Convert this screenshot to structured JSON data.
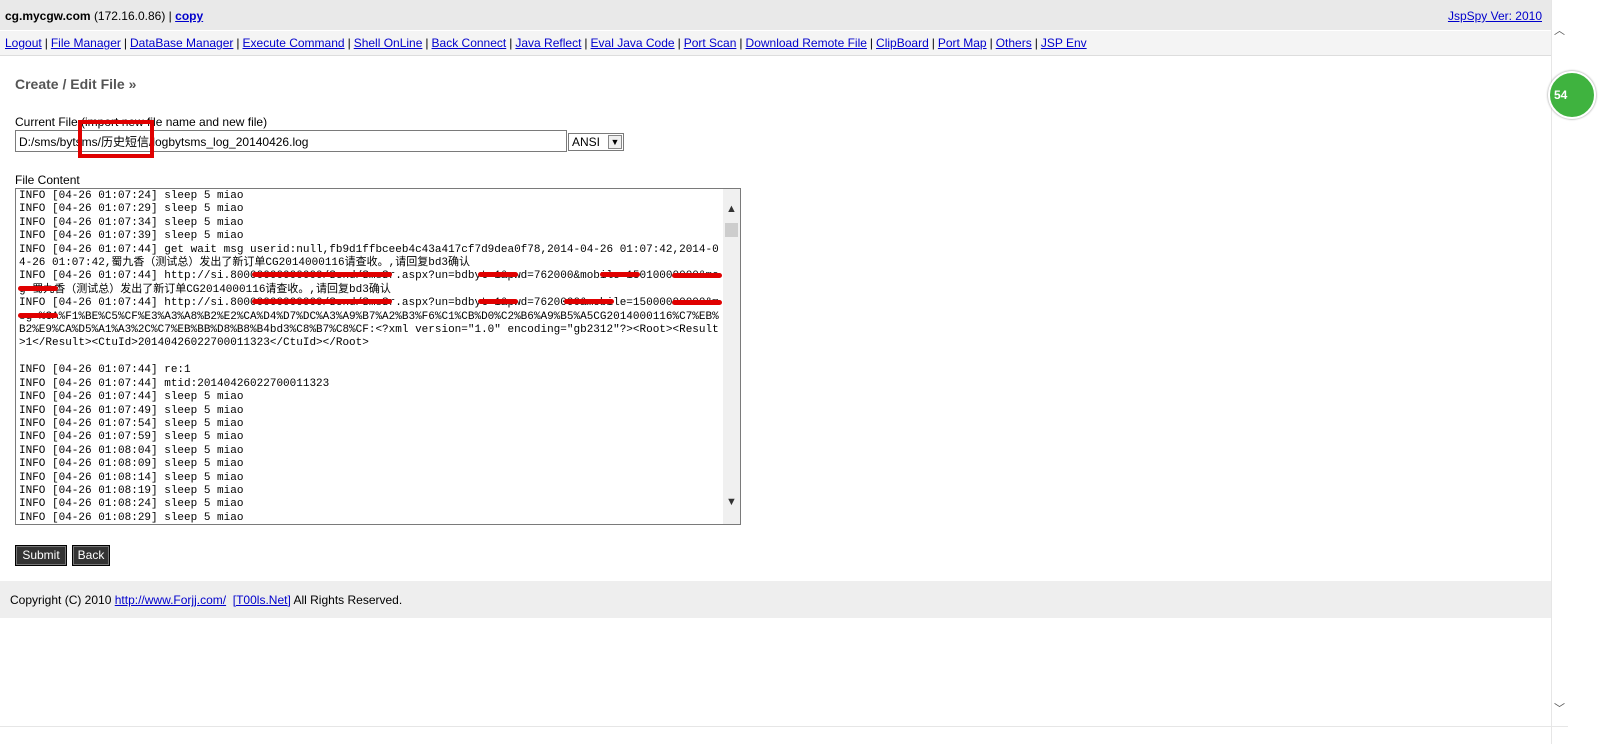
{
  "header": {
    "host": "cg.mycgw.com",
    "ip": "(172.16.0.86)",
    "sep": "|",
    "copy": "copy",
    "version": "JspSpy Ver: 2010"
  },
  "nav": [
    "Logout",
    "File Manager",
    "DataBase Manager",
    "Execute Command",
    "Shell OnLine",
    "Back Connect",
    "Java Reflect",
    "Eval Java Code",
    "Port Scan",
    "Download Remote File",
    "ClipBoard",
    "Port Map",
    "Others",
    "JSP Env"
  ],
  "title": "Create / Edit File »",
  "current_file_label": "Current File (import new file name and new file)",
  "current_file_value": "D:/sms/bytsms/历史短信/logbytsms_log_20140426.log",
  "encoding": "ANSI",
  "content_label": "File Content",
  "file_content": "INFO [04-26 01:07:24] sleep 5 miao\nINFO [04-26 01:07:29] sleep 5 miao\nINFO [04-26 01:07:34] sleep 5 miao\nINFO [04-26 01:07:39] sleep 5 miao\nINFO [04-26 01:07:44] get wait msg userid:null,fb9d1ffbceeb4c43a417cf7d9dea0f78,2014-04-26 01:07:42,2014-04-26 01:07:42,蜀九香（测试总）发出了新订单CG2014000116请查收。,请回复bd3确认\nINFO [04-26 01:07:44] http://si.80000000000000/Send/SmsSr.aspx?un=bdbyt-1&pwd=762000&mobile=15010000000&msg=蜀九香（测试总）发出了新订单CG2014000116请查收。,请回复bd3确认\nINFO [04-26 01:07:44] http://si.80000000000000/Send/SmsSr.aspx?un=bdbyt-1&pwd=7620000&mobile=15000000000&msg=%CA%F1%BE%C5%CF%E3%A3%A8%B2%E2%CA%D4%D7%DC%A3%A9%B7%A2%B3%F6%C1%CB%D0%C2%B6%A9%B5%A5CG2014000116%C7%EB%B2%E9%CA%D5%A1%A3%2C%C7%EB%BB%D8%B8%B4bd3%C8%B7%C8%CF:<?xml version=\"1.0\" encoding=\"gb2312\"?><Root><Result>1</Result><CtuId>20140426022700011323</CtuId></Root>\n\nINFO [04-26 01:07:44] re:1\nINFO [04-26 01:07:44] mtid:20140426022700011323\nINFO [04-26 01:07:44] sleep 5 miao\nINFO [04-26 01:07:49] sleep 5 miao\nINFO [04-26 01:07:54] sleep 5 miao\nINFO [04-26 01:07:59] sleep 5 miao\nINFO [04-26 01:08:04] sleep 5 miao\nINFO [04-26 01:08:09] sleep 5 miao\nINFO [04-26 01:08:14] sleep 5 miao\nINFO [04-26 01:08:19] sleep 5 miao\nINFO [04-26 01:08:24] sleep 5 miao\nINFO [04-26 01:08:29] sleep 5 miao",
  "buttons": {
    "submit": "Submit",
    "back": "Back"
  },
  "footer": {
    "copyright": "Copyright (C) 2010",
    "link1": "http://www.Forjj.com/",
    "link2": "[T00ls.Net]",
    "rights": "All Rights Reserved."
  },
  "badge": "54"
}
